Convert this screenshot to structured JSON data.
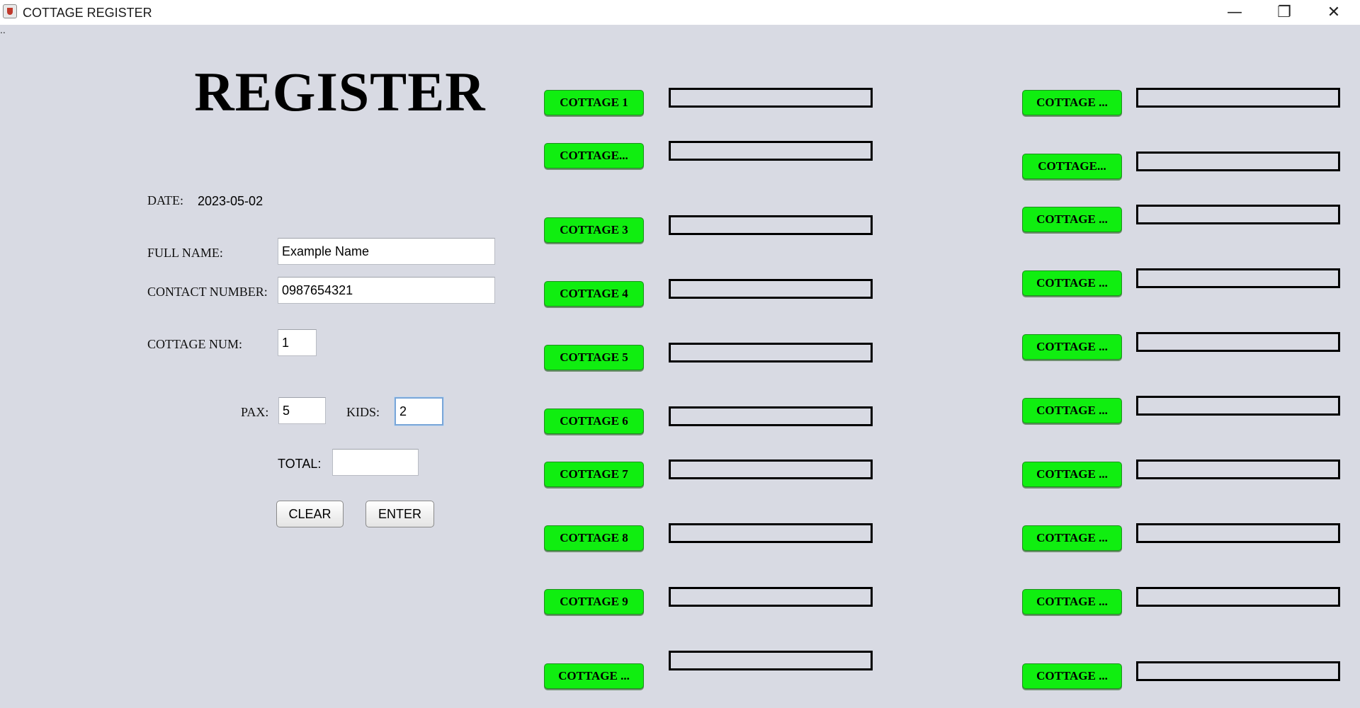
{
  "window": {
    "title": "COTTAGE REGISTER",
    "icon": "java-app-icon",
    "minimize": "—",
    "maximize": "❐",
    "close": "✕"
  },
  "menu": {
    "dots": ".."
  },
  "form": {
    "heading": "REGISTER",
    "date_label": "DATE:",
    "date_value": "2023-05-02",
    "fullname_label": "FULL NAME:",
    "fullname_value": "Example Name",
    "contact_label": "CONTACT NUMBER:",
    "contact_value": "0987654321",
    "cottage_num_label": "COTTAGE NUM:",
    "cottage_num_value": "1",
    "pax_label": "PAX:",
    "pax_value": "5",
    "kids_label": "KIDS:",
    "kids_value": "2",
    "total_label": "TOTAL:",
    "total_value": "",
    "clear_label": "CLEAR",
    "enter_label": "ENTER"
  },
  "cottages_left": [
    {
      "label": "COTTAGE 1",
      "value": ""
    },
    {
      "label": "COTTAGE...",
      "value": ""
    },
    {
      "label": "COTTAGE 3",
      "value": ""
    },
    {
      "label": "COTTAGE 4",
      "value": ""
    },
    {
      "label": "COTTAGE 5",
      "value": ""
    },
    {
      "label": "COTTAGE 6",
      "value": ""
    },
    {
      "label": "COTTAGE 7",
      "value": ""
    },
    {
      "label": "COTTAGE 8",
      "value": ""
    },
    {
      "label": "COTTAGE 9",
      "value": ""
    },
    {
      "label": "COTTAGE ...",
      "value": ""
    }
  ],
  "cottages_right": [
    {
      "label": "COTTAGE ...",
      "value": ""
    },
    {
      "label": "COTTAGE...",
      "value": ""
    },
    {
      "label": "COTTAGE ...",
      "value": ""
    },
    {
      "label": "COTTAGE ...",
      "value": ""
    },
    {
      "label": "COTTAGE ...",
      "value": ""
    },
    {
      "label": "COTTAGE ...",
      "value": ""
    },
    {
      "label": "COTTAGE ...",
      "value": ""
    },
    {
      "label": "COTTAGE ...",
      "value": ""
    },
    {
      "label": "COTTAGE ...",
      "value": ""
    },
    {
      "label": "COTTAGE ...",
      "value": ""
    }
  ],
  "colors": {
    "cottage_button": "#10ee10",
    "background": "#d8dae3"
  }
}
